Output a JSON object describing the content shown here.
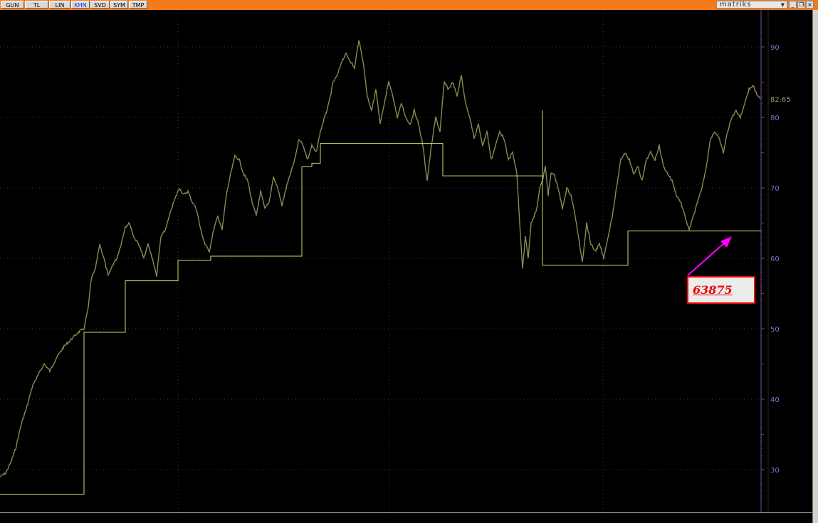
{
  "toolbar": {
    "tabs": [
      {
        "label": "GUN",
        "active": false
      },
      {
        "label": "TL",
        "active": false
      },
      {
        "label": "LIN",
        "active": false
      },
      {
        "label": "KHN",
        "active": true
      },
      {
        "label": "SVD",
        "active": false
      },
      {
        "label": "SYM",
        "active": false
      },
      {
        "label": "TMP",
        "active": false
      }
    ],
    "brand": "matriks",
    "brand_dropdown": "▼",
    "window_buttons": [
      "_",
      "❐",
      "×"
    ],
    "bar_color": "#f57a1a"
  },
  "chart_data": {
    "type": "line",
    "title": "",
    "xlabel": "",
    "ylabel": "",
    "ylim": [
      24,
      96
    ],
    "y_ticks": [
      90,
      80,
      70,
      60,
      50,
      40,
      30
    ],
    "last_value_label": "82.65",
    "grid": true,
    "series": [
      {
        "type": "line",
        "color": "#8a8a52",
        "points": [
          [
            0,
            29
          ],
          [
            8,
            29.5
          ],
          [
            15,
            31
          ],
          [
            22,
            33
          ],
          [
            30,
            36.5
          ],
          [
            38,
            39
          ],
          [
            46,
            42
          ],
          [
            54,
            43.5
          ],
          [
            62,
            45
          ],
          [
            70,
            44
          ],
          [
            80,
            46
          ],
          [
            90,
            47.5
          ],
          [
            100,
            48.5
          ],
          [
            110,
            49.5
          ],
          [
            118,
            50
          ],
          [
            124,
            53
          ],
          [
            128,
            57
          ],
          [
            134,
            58.5
          ],
          [
            140,
            62
          ],
          [
            146,
            60
          ],
          [
            152,
            57.5
          ],
          [
            158,
            59
          ],
          [
            164,
            60
          ],
          [
            170,
            62
          ],
          [
            176,
            64.5
          ],
          [
            182,
            65
          ],
          [
            188,
            63
          ],
          [
            195,
            62
          ],
          [
            202,
            60
          ],
          [
            208,
            62
          ],
          [
            214,
            60
          ],
          [
            220,
            57.5
          ],
          [
            226,
            63
          ],
          [
            232,
            64
          ],
          [
            238,
            66
          ],
          [
            244,
            68
          ],
          [
            252,
            70
          ],
          [
            258,
            69
          ],
          [
            264,
            69.5
          ],
          [
            270,
            68
          ],
          [
            276,
            67
          ],
          [
            282,
            64
          ],
          [
            288,
            62
          ],
          [
            294,
            61
          ],
          [
            300,
            64
          ],
          [
            306,
            66
          ],
          [
            312,
            64
          ],
          [
            318,
            69
          ],
          [
            324,
            72
          ],
          [
            330,
            74.5
          ],
          [
            336,
            74
          ],
          [
            342,
            72
          ],
          [
            348,
            71
          ],
          [
            354,
            68
          ],
          [
            360,
            66
          ],
          [
            366,
            69.5
          ],
          [
            372,
            67
          ],
          [
            378,
            68
          ],
          [
            384,
            71.5
          ],
          [
            390,
            70
          ],
          [
            396,
            67.5
          ],
          [
            402,
            70
          ],
          [
            408,
            72
          ],
          [
            414,
            74
          ],
          [
            420,
            77
          ],
          [
            426,
            76
          ],
          [
            432,
            74
          ],
          [
            438,
            76
          ],
          [
            444,
            75
          ],
          [
            450,
            78
          ],
          [
            456,
            80
          ],
          [
            462,
            82
          ],
          [
            468,
            85
          ],
          [
            474,
            86
          ],
          [
            480,
            88
          ],
          [
            486,
            89
          ],
          [
            492,
            88
          ],
          [
            498,
            87
          ],
          [
            504,
            91
          ],
          [
            510,
            88
          ],
          [
            516,
            83
          ],
          [
            522,
            81
          ],
          [
            528,
            84
          ],
          [
            534,
            79
          ],
          [
            540,
            82
          ],
          [
            546,
            85
          ],
          [
            552,
            83
          ],
          [
            558,
            80
          ],
          [
            564,
            82
          ],
          [
            570,
            80
          ],
          [
            576,
            79
          ],
          [
            582,
            81
          ],
          [
            588,
            79
          ],
          [
            594,
            76
          ],
          [
            600,
            71
          ],
          [
            606,
            76
          ],
          [
            612,
            80
          ],
          [
            618,
            78
          ],
          [
            624,
            85
          ],
          [
            630,
            84
          ],
          [
            636,
            85
          ],
          [
            642,
            83
          ],
          [
            648,
            86
          ],
          [
            654,
            82
          ],
          [
            660,
            80
          ],
          [
            666,
            77
          ],
          [
            672,
            79
          ],
          [
            678,
            76
          ],
          [
            684,
            78
          ],
          [
            690,
            74
          ],
          [
            696,
            76
          ],
          [
            702,
            78
          ],
          [
            708,
            77
          ],
          [
            714,
            74
          ],
          [
            720,
            75
          ],
          [
            726,
            72
          ],
          [
            730,
            65
          ],
          [
            734,
            58.5
          ],
          [
            738,
            63
          ],
          [
            742,
            60
          ],
          [
            746,
            65
          ],
          [
            750,
            66
          ],
          [
            754,
            67
          ],
          [
            758,
            70
          ],
          [
            762,
            71
          ],
          [
            766,
            73
          ],
          [
            770,
            69
          ],
          [
            774,
            72
          ],
          [
            778,
            72
          ],
          [
            784,
            70
          ],
          [
            790,
            67
          ],
          [
            796,
            70
          ],
          [
            802,
            69
          ],
          [
            808,
            66
          ],
          [
            814,
            62
          ],
          [
            818,
            59.5
          ],
          [
            824,
            65
          ],
          [
            830,
            62
          ],
          [
            836,
            61
          ],
          [
            842,
            62
          ],
          [
            848,
            60
          ],
          [
            854,
            63
          ],
          [
            860,
            66
          ],
          [
            866,
            70
          ],
          [
            872,
            74
          ],
          [
            878,
            75
          ],
          [
            884,
            74
          ],
          [
            890,
            72
          ],
          [
            896,
            73
          ],
          [
            902,
            71
          ],
          [
            908,
            74
          ],
          [
            914,
            75
          ],
          [
            920,
            74
          ],
          [
            926,
            76
          ],
          [
            932,
            73
          ],
          [
            938,
            72
          ],
          [
            944,
            71
          ],
          [
            950,
            69
          ],
          [
            956,
            68
          ],
          [
            962,
            66
          ],
          [
            968,
            64
          ],
          [
            974,
            66
          ],
          [
            980,
            68
          ],
          [
            986,
            70
          ],
          [
            992,
            73
          ],
          [
            998,
            77
          ],
          [
            1004,
            78
          ],
          [
            1010,
            77
          ],
          [
            1016,
            75
          ],
          [
            1022,
            78
          ],
          [
            1028,
            80
          ],
          [
            1034,
            81
          ],
          [
            1040,
            80
          ],
          [
            1046,
            82
          ],
          [
            1052,
            84
          ],
          [
            1058,
            84.5
          ],
          [
            1064,
            83
          ],
          [
            1068,
            82.65
          ]
        ]
      },
      {
        "type": "step",
        "color": "#d8d870",
        "segments": [
          {
            "from": 0,
            "to": 118,
            "value": 26.5
          },
          {
            "from": 118,
            "to": 176,
            "value": 49.5
          },
          {
            "from": 176,
            "to": 250,
            "value": 56.8
          },
          {
            "from": 250,
            "to": 296,
            "value": 59.7
          },
          {
            "from": 296,
            "to": 424,
            "value": 60.3
          },
          {
            "from": 424,
            "to": 438,
            "value": 73
          },
          {
            "from": 438,
            "to": 450,
            "value": 73.5
          },
          {
            "from": 450,
            "to": 622,
            "value": 76.3
          },
          {
            "from": 622,
            "to": 762,
            "value": 71.7
          },
          {
            "from": 762,
            "to": 882,
            "value": 59
          },
          {
            "from": 882,
            "to": 1069,
            "value": 63.875
          }
        ],
        "spike": {
          "x": 762,
          "value": 81
        }
      }
    ],
    "vertical_grid_x": [
      250,
      547,
      847
    ]
  },
  "annotation": {
    "text": "63875",
    "arrow_color": "#ff00ff",
    "box_border_color": "#e00000"
  }
}
